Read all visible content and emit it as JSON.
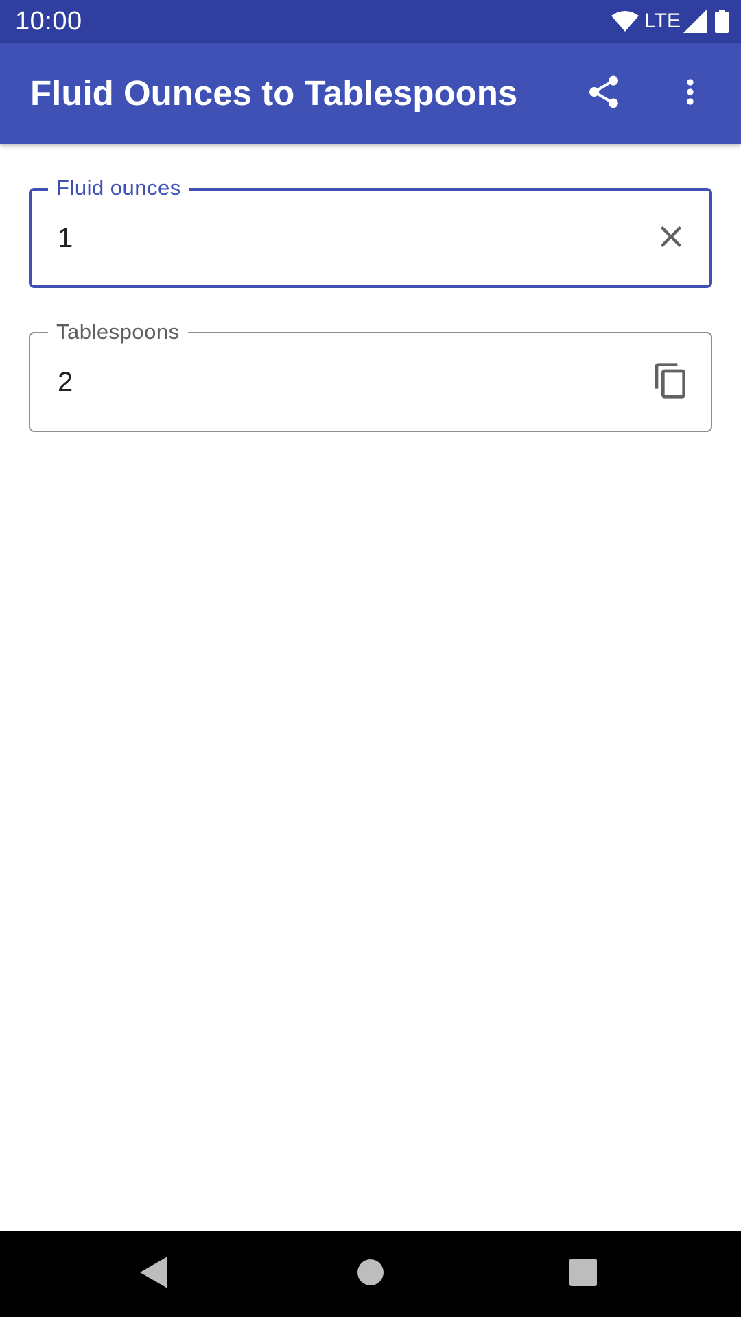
{
  "status_bar": {
    "time": "10:00",
    "network": "LTE",
    "icons": [
      "wifi-icon",
      "cell-signal-icon",
      "battery-icon"
    ]
  },
  "app_bar": {
    "title": "Fluid Ounces to Tablespoons",
    "actions": [
      "share-icon",
      "more-vert-icon"
    ]
  },
  "fields": {
    "input": {
      "label": "Fluid ounces",
      "value": "1",
      "action_icon": "close-icon",
      "focused": true
    },
    "output": {
      "label": "Tablespoons",
      "value": "2",
      "action_icon": "copy-icon",
      "focused": false
    }
  },
  "nav_bar": {
    "buttons": [
      "back-icon",
      "home-icon",
      "recents-icon"
    ]
  },
  "colors": {
    "status_bar": "#303f9f",
    "app_bar": "#3f51b5",
    "focused_outline": "#3f51b5",
    "outline": "#8f8f8f",
    "icon": "#616161",
    "nav_bar": "#000000"
  }
}
